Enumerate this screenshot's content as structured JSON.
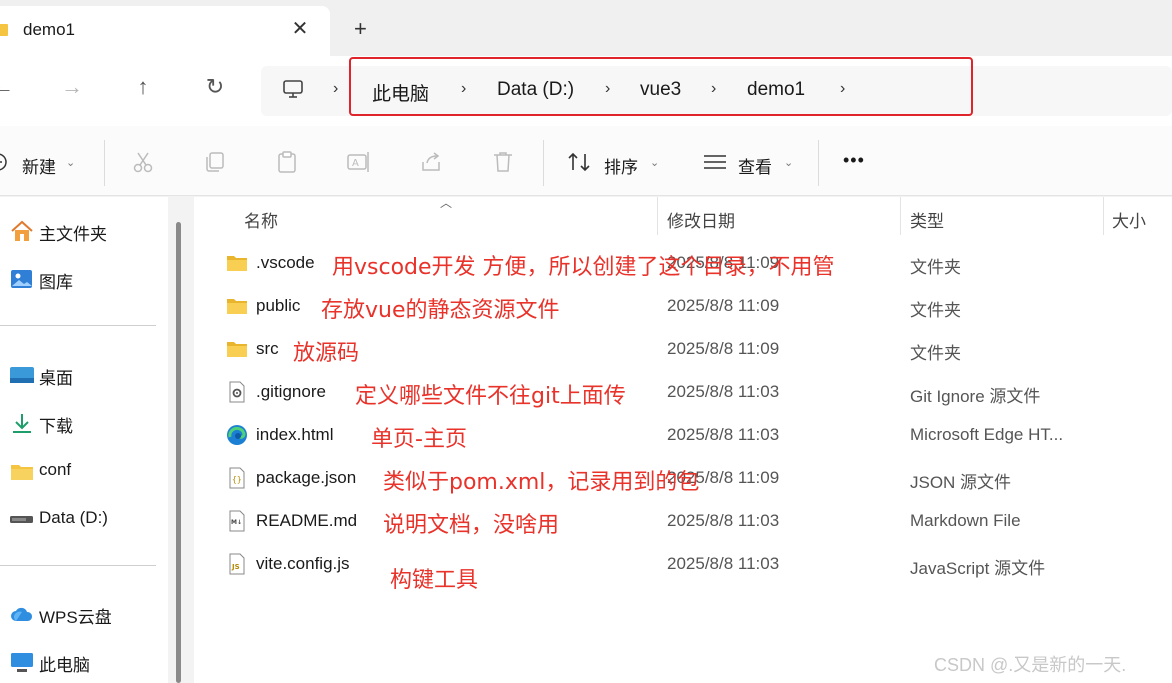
{
  "tab": {
    "title": "demo1",
    "close": "✕",
    "new_tab": "+"
  },
  "nav": {
    "back": "←",
    "forward": "→",
    "up": "↑",
    "refresh": "↻",
    "chevron": "›"
  },
  "breadcrumb": [
    "此电脑",
    "Data (D:)",
    "vue3",
    "demo1"
  ],
  "toolbar": {
    "new_label": "新建",
    "sort_label": "排序",
    "view_label": "查看",
    "more_label": "•••"
  },
  "sidebar": {
    "items": [
      {
        "label": "主文件夹",
        "icon": "home-icon"
      },
      {
        "label": "图库",
        "icon": "gallery-icon"
      },
      {
        "label": "桌面",
        "icon": "desktop-icon"
      },
      {
        "label": "下载",
        "icon": "download-icon"
      },
      {
        "label": "conf",
        "icon": "folder-icon"
      },
      {
        "label": "Data (D:)",
        "icon": "drive-icon"
      },
      {
        "label": "WPS云盘",
        "icon": "cloud-icon"
      },
      {
        "label": "此电脑",
        "icon": "pc-icon"
      }
    ]
  },
  "columns": {
    "name": "名称",
    "date": "修改日期",
    "type": "类型",
    "size": "大小"
  },
  "files": [
    {
      "name": ".vscode",
      "date": "2025/8/8 11:09",
      "type": "文件夹",
      "icon": "folder-icon",
      "note": "用vscode开发 方便，所以创建了这个目录，不用管"
    },
    {
      "name": "public",
      "date": "2025/8/8 11:09",
      "type": "文件夹",
      "icon": "folder-icon",
      "note": "存放vue的静态资源文件"
    },
    {
      "name": "src",
      "date": "2025/8/8 11:09",
      "type": "文件夹",
      "icon": "folder-icon",
      "note": "放源码"
    },
    {
      "name": ".gitignore",
      "date": "2025/8/8 11:03",
      "type": "Git Ignore 源文件",
      "icon": "gear-file-icon",
      "note": "定义哪些文件不往git上面传"
    },
    {
      "name": "index.html",
      "date": "2025/8/8 11:03",
      "type": "Microsoft Edge HT...",
      "icon": "edge-icon",
      "note": "单页-主页"
    },
    {
      "name": "package.json",
      "date": "2025/8/8 11:09",
      "type": "JSON 源文件",
      "icon": "json-file-icon",
      "note": "类似于pom.xml，记录用到的包"
    },
    {
      "name": "README.md",
      "date": "2025/8/8 11:03",
      "type": "Markdown File",
      "icon": "markdown-file-icon",
      "note": "说明文档，没啥用"
    },
    {
      "name": "vite.config.js",
      "date": "2025/8/8 11:03",
      "type": "JavaScript 源文件",
      "icon": "js-file-icon",
      "note": "构键工具"
    }
  ],
  "watermark": "CSDN @.又是新的一天.",
  "colors": {
    "annotation": "#e8322a",
    "highlight_box": "#e0242b",
    "folder": "#f5c542"
  }
}
